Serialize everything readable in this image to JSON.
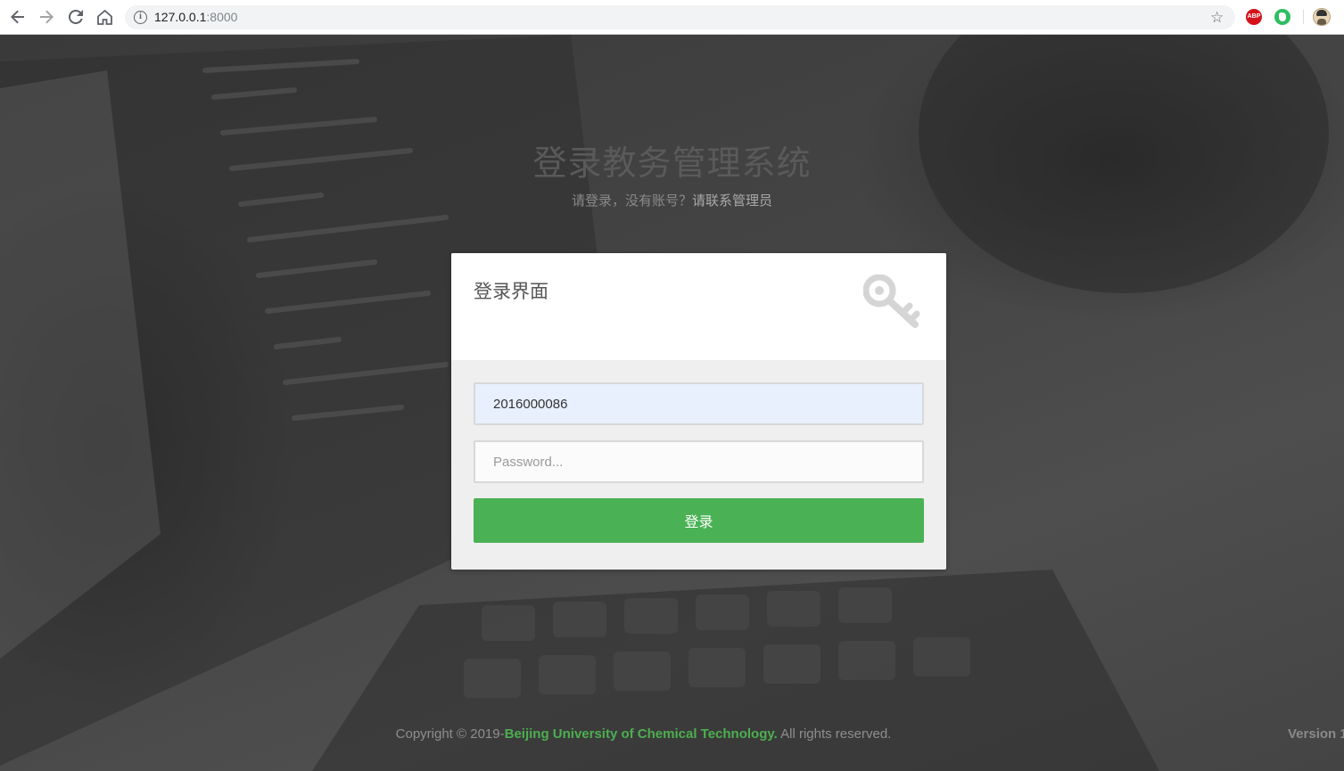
{
  "browser": {
    "url_host": "127.0.0.1",
    "url_port": ":8000",
    "abp_label": "ABP"
  },
  "page": {
    "heading": "登录教务管理系统",
    "subheading_prefix": "请登录，没有账号？",
    "subheading_contact": "请联系管理员"
  },
  "login": {
    "title": "登录界面",
    "username_value": "2016000086",
    "password_placeholder": "Password...",
    "submit_label": "登录",
    "accent_color": "#4ab254"
  },
  "footer": {
    "prefix": "Copyright © 2019-",
    "organization": "Beijing University of Chemical Technology.",
    "suffix": " All rights reserved.",
    "version_label": "Version 1"
  },
  "icons": [
    "back-icon",
    "forward-icon",
    "reload-icon",
    "home-icon",
    "info-icon",
    "star-icon",
    "adblock-plus-icon",
    "evernote-icon",
    "profile-avatar",
    "key-icon"
  ]
}
